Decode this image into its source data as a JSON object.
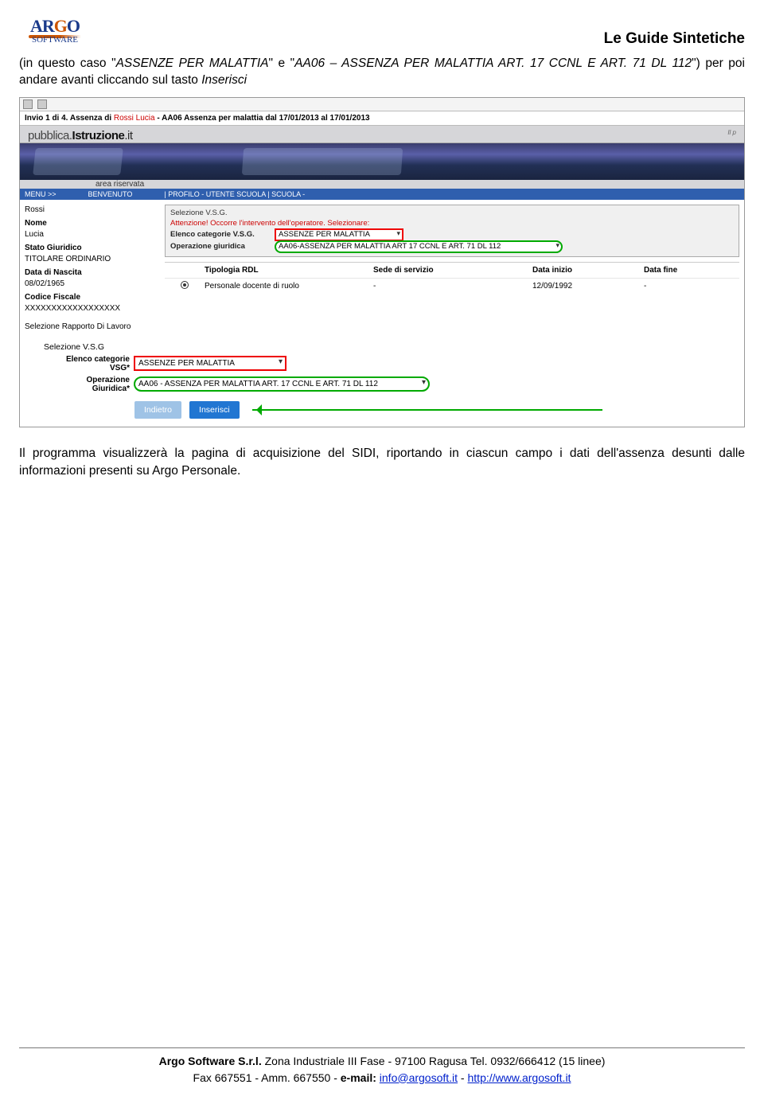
{
  "header": {
    "logo_top": "AR",
    "logo_g": "G",
    "logo_o": "O",
    "logo_sub": "SOFTWARE",
    "doc_title": "Le Guide Sintetiche"
  },
  "para1_a": "(in questo caso \"",
  "para1_b": "ASSENZE PER MALATTIA",
  "para1_c": "\" e \"",
  "para1_d": "AA06 – ASSENZA PER MALATTIA ART. 17 CCNL E ART. 71 DL 112",
  "para1_e": "\") per poi andare avanti cliccando sul tasto ",
  "para1_f": "Inserisci",
  "shot": {
    "invio": "Invio 1 di 4. Assenza di  ",
    "name_red": "Rossi Lucia",
    "desc": "  - AA06 Assenza per malattia dal 17/01/2013 al 17/01/2013",
    "istr_pub": "pubblica.",
    "istr_main": "Istruzione",
    "istr_dot": ".it",
    "istr_tiny": "Il p",
    "area": "area riservata",
    "menu": "MENU >>",
    "benv": "BENVENUTO",
    "prof": "| PROFILO - UTENTE SCUOLA | SCUOLA -",
    "left": {
      "l1": "Rossi",
      "l2": "Nome",
      "l3": "Lucia",
      "l4": "Stato Giuridico",
      "l5": "TITOLARE ORDINARIO",
      "l6": "Data di Nascita",
      "l7": "08/02/1965",
      "l8": "Codice Fiscale",
      "l9": "XXXXXXXXXXXXXXXXXX",
      "l10": "Selezione Rapporto Di Lavoro"
    },
    "gb": {
      "hdr": "Selezione V.S.G.",
      "warn": "Attenzione! Occorre l'intervento dell'operatore. Selezionare:",
      "k1": "Elenco categorie V.S.G.",
      "v1": "ASSENZE PER MALATTIA",
      "k2": "Operazione giuridica",
      "v2": "AA06-ASSENZA PER MALATTIA ART 17 CCNL E ART. 71 DL 112"
    },
    "tbl": {
      "h1": "Tipologia RDL",
      "h2": "Sede di servizio",
      "h3": "Data inizio",
      "h4": "Data fine",
      "r1": "Personale docente di ruolo",
      "r2": "-",
      "r3": "12/09/1992",
      "r4": "-"
    },
    "vsg": {
      "title": "Selezione V.S.G",
      "k1a": "Elenco categorie",
      "k1b": "VSG*",
      "v1": "ASSENZE PER MALATTIA",
      "k2a": "Operazione",
      "k2b": "Giuridica*",
      "v2": "AA06 - ASSENZA PER MALATTIA ART. 17 CCNL E ART. 71 DL 112",
      "b1": "Indietro",
      "b2": "Inserisci"
    }
  },
  "para2": "Il programma visualizzerà la pagina di acquisizione del SIDI, riportando in ciascun campo i dati dell'assenza desunti dalle informazioni presenti su Argo Personale.",
  "footer": {
    "l1a": "Argo Software S.r.l.",
    "l1b": " Zona Industriale III Fase - 97100 Ragusa Tel. 0932/666412 (15 linee)",
    "l2a": "Fax 667551 - Amm. 667550 - ",
    "l2b": "e-mail: ",
    "l2c": "info@argosoft.it",
    "l2d": " - ",
    "l2e": "http://www.argosoft.it"
  }
}
